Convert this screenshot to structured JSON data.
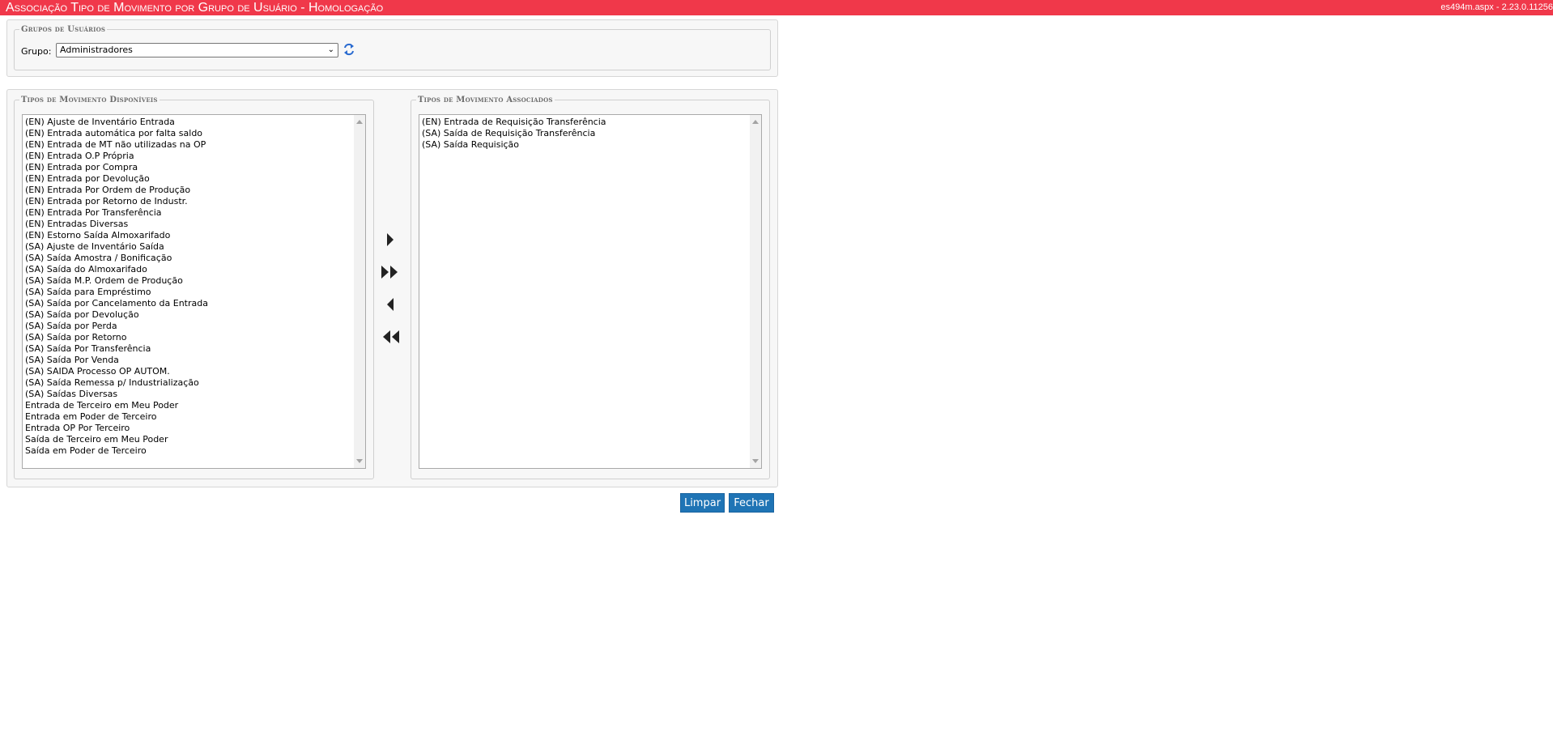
{
  "header": {
    "title": "Associação Tipo de Movimento por Grupo de Usuário  - Homologação",
    "version": "es494m.aspx - 2.23.0.11256"
  },
  "grupos": {
    "legend": "Grupos de Usuários",
    "label": "Grupo:",
    "selected": "Administradores"
  },
  "disponiveis": {
    "legend": "Tipos de Movimento Disponíveis",
    "items": [
      "(EN) Ajuste de Inventário Entrada",
      "(EN) Entrada automática por falta saldo",
      "(EN) Entrada de MT não utilizadas na OP",
      "(EN) Entrada O.P Própria",
      "(EN) Entrada por Compra",
      "(EN) Entrada por Devolução",
      "(EN) Entrada Por Ordem de Produção",
      "(EN) Entrada por Retorno de Industr.",
      "(EN) Entrada Por Transferência",
      "(EN) Entradas Diversas",
      "(EN) Estorno Saída Almoxarifado",
      "(SA) Ajuste de Inventário Saída",
      "(SA) Saída Amostra / Bonificação",
      "(SA) Saída do Almoxarifado",
      "(SA) Saída M.P. Ordem de Produção",
      "(SA) Saída para Empréstimo",
      "(SA) Saída por Cancelamento da Entrada",
      "(SA) Saída por Devolução",
      "(SA) Saída por Perda",
      "(SA) Saída por Retorno",
      "(SA) Saída Por Transferência",
      "(SA) Saída Por Venda",
      "(SA) SAIDA Processo OP AUTOM.",
      "(SA) Saída Remessa p/ Industrialização",
      "(SA) Saídas Diversas",
      "Entrada de Terceiro em Meu Poder",
      "Entrada em Poder de Terceiro",
      "Entrada OP Por Terceiro",
      "Saída de Terceiro em Meu Poder",
      "Saída em Poder de Terceiro"
    ]
  },
  "associados": {
    "legend": "Tipos de Movimento Associados",
    "items": [
      "(EN) Entrada de Requisição Transferência",
      "(SA) Saída de Requisição Transferência",
      "(SA) Saída Requisição"
    ]
  },
  "buttons": {
    "limpar": "Limpar",
    "fechar": "Fechar"
  },
  "colors": {
    "header": "#f0384a",
    "button": "#1f74b5",
    "arrows": "#222222",
    "refresh": "#2a6bd0"
  },
  "icons": {
    "move_one_right": "caret-right-icon",
    "move_all_right": "double-caret-right-icon",
    "move_one_left": "caret-left-icon",
    "move_all_left": "double-caret-left-icon",
    "refresh": "refresh-icon"
  }
}
